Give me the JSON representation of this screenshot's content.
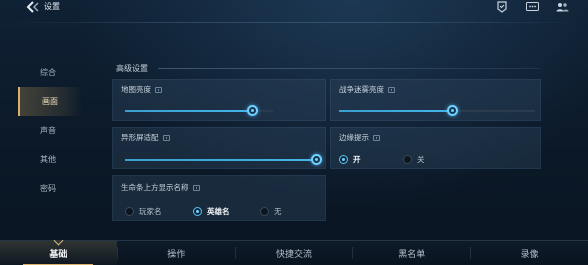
{
  "header": {
    "title": "设置"
  },
  "sidebar": {
    "items": [
      {
        "label": "综合"
      },
      {
        "label": "画面"
      },
      {
        "label": "声音"
      },
      {
        "label": "其他"
      },
      {
        "label": "密码"
      }
    ],
    "active_index": 1
  },
  "main": {
    "section_title": "高级设置",
    "map_brightness": {
      "label": "地图亮度",
      "value": 0.86
    },
    "fog_brightness": {
      "label": "战争迷雾亮度",
      "value": 0.58
    },
    "notch_adapt": {
      "label": "异形屏适配",
      "value": 1.0
    },
    "edge_hint": {
      "label": "边缘提示",
      "options": [
        "开",
        "关"
      ],
      "selected": "开"
    },
    "name_above_hp": {
      "label": "生命条上方显示名称",
      "options": [
        "玩家名",
        "英雄名",
        "无"
      ],
      "selected": "英雄名"
    }
  },
  "bottom_nav": {
    "items": [
      {
        "label": "基础"
      },
      {
        "label": "操作"
      },
      {
        "label": "快捷交流"
      },
      {
        "label": "黑名单"
      },
      {
        "label": "录像"
      }
    ],
    "active_index": 0
  },
  "colors": {
    "accent": "#43b6ea",
    "gold": "#d8b06a",
    "background": "#0b1826"
  }
}
